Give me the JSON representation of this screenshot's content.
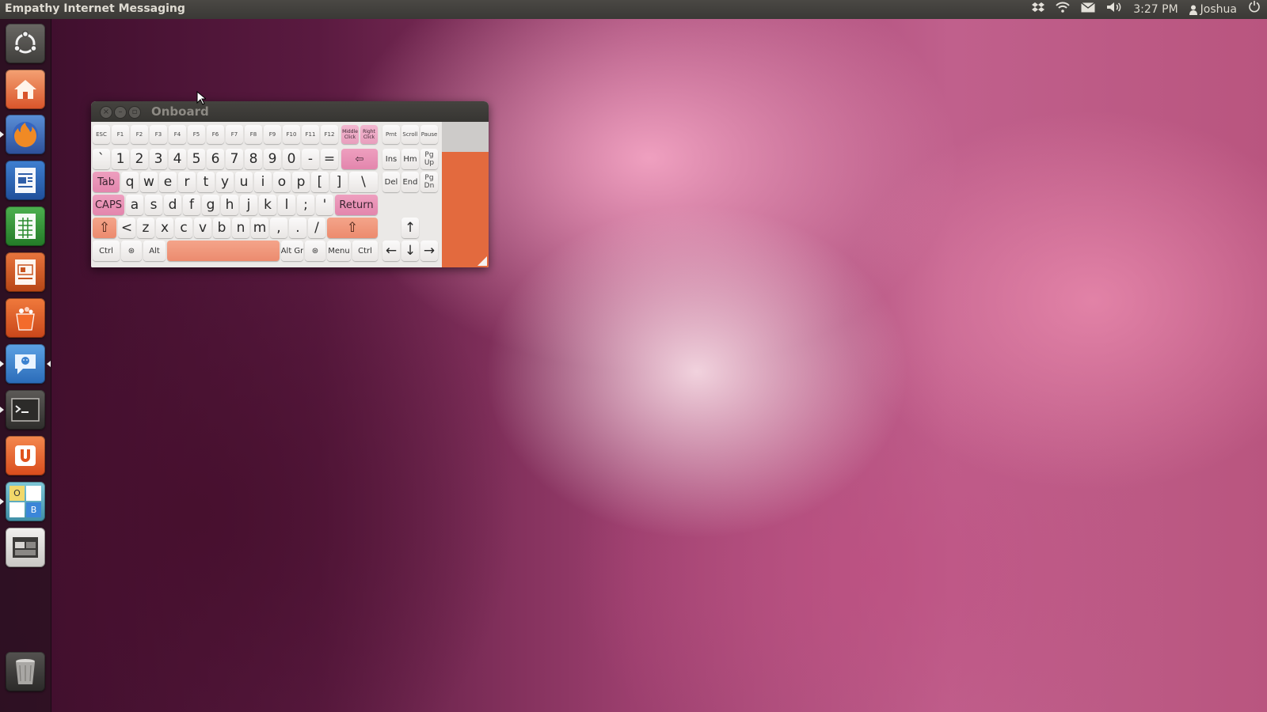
{
  "top_panel": {
    "app_title": "Empathy Internet Messaging",
    "tray_icons": [
      "dropbox-icon",
      "wifi-icon",
      "mail-icon",
      "volume-icon"
    ],
    "clock": "3:27 PM",
    "user": "Joshua",
    "session_icon": "power-icon"
  },
  "launcher": {
    "items": [
      "ubuntu-logo-icon",
      "home-folder-icon",
      "firefox-icon",
      "writer-icon",
      "calc-icon",
      "impress-icon",
      "software-center-icon",
      "empathy-icon",
      "terminal-icon",
      "ubuntu-one-icon",
      "workspaces-icon",
      "window-switcher-icon",
      "trash-icon"
    ],
    "workspaces_letters": [
      "O",
      "B"
    ]
  },
  "window": {
    "title": "Onboard"
  },
  "keyboard": {
    "fn_row": [
      "ESC",
      "F1",
      "F2",
      "F3",
      "F4",
      "F5",
      "F6",
      "F7",
      "F8",
      "F9",
      "F10",
      "F11",
      "F12"
    ],
    "mouse_keys": [
      "Middle Click",
      "Right Click"
    ],
    "sys_keys": [
      "Prnt",
      "Scroll",
      "Pause"
    ],
    "num_row": [
      "`",
      "1",
      "2",
      "3",
      "4",
      "5",
      "6",
      "7",
      "8",
      "9",
      "0",
      "-",
      "="
    ],
    "backspace": "⇦",
    "tab": "Tab",
    "q_row": [
      "q",
      "w",
      "e",
      "r",
      "t",
      "y",
      "u",
      "i",
      "o",
      "p",
      "[",
      "]",
      "\\"
    ],
    "caps": "CAPS",
    "a_row": [
      "a",
      "s",
      "d",
      "f",
      "g",
      "h",
      "j",
      "k",
      "l",
      ";",
      "'"
    ],
    "return": "Return",
    "shift": "⇧",
    "z_row": [
      "<",
      "z",
      "x",
      "c",
      "v",
      "b",
      "n",
      "m",
      ",",
      ".",
      "/"
    ],
    "ctrl": "Ctrl",
    "super": "⊛",
    "alt": "Alt",
    "altgr": "Alt Gr",
    "menu": "Menu",
    "nav_top": [
      "Ins",
      "Hm",
      "Pg Up"
    ],
    "nav_bottom": [
      "Del",
      "End",
      "Pg Dn"
    ],
    "arrow_up": "↑",
    "arrows": [
      "←",
      "↓",
      "→"
    ]
  },
  "colors": {
    "accent_orange": "#e36a3e",
    "pink_key": "#e89ebd"
  }
}
